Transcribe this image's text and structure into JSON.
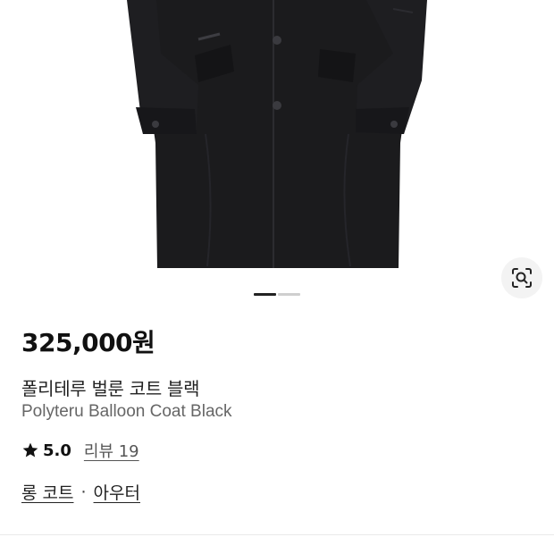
{
  "product": {
    "price": "325,000원",
    "name_ko": "폴리테루 벌룬 코트 블랙",
    "name_en": "Polyteru Balloon Coat Black",
    "rating": "5.0",
    "review_label": "리뷰 19",
    "categories": [
      "롱 코트",
      "아우터"
    ],
    "category_separator": "·"
  },
  "gallery": {
    "current_image": 1,
    "total_images": 2,
    "lens_icon": "lens-search-icon"
  },
  "colors": {
    "coat": "#1b1b1d",
    "price_text": "#111111",
    "subtitle_text": "#666666",
    "active_dot": "#222222",
    "inactive_dot": "#cfcfcf"
  }
}
